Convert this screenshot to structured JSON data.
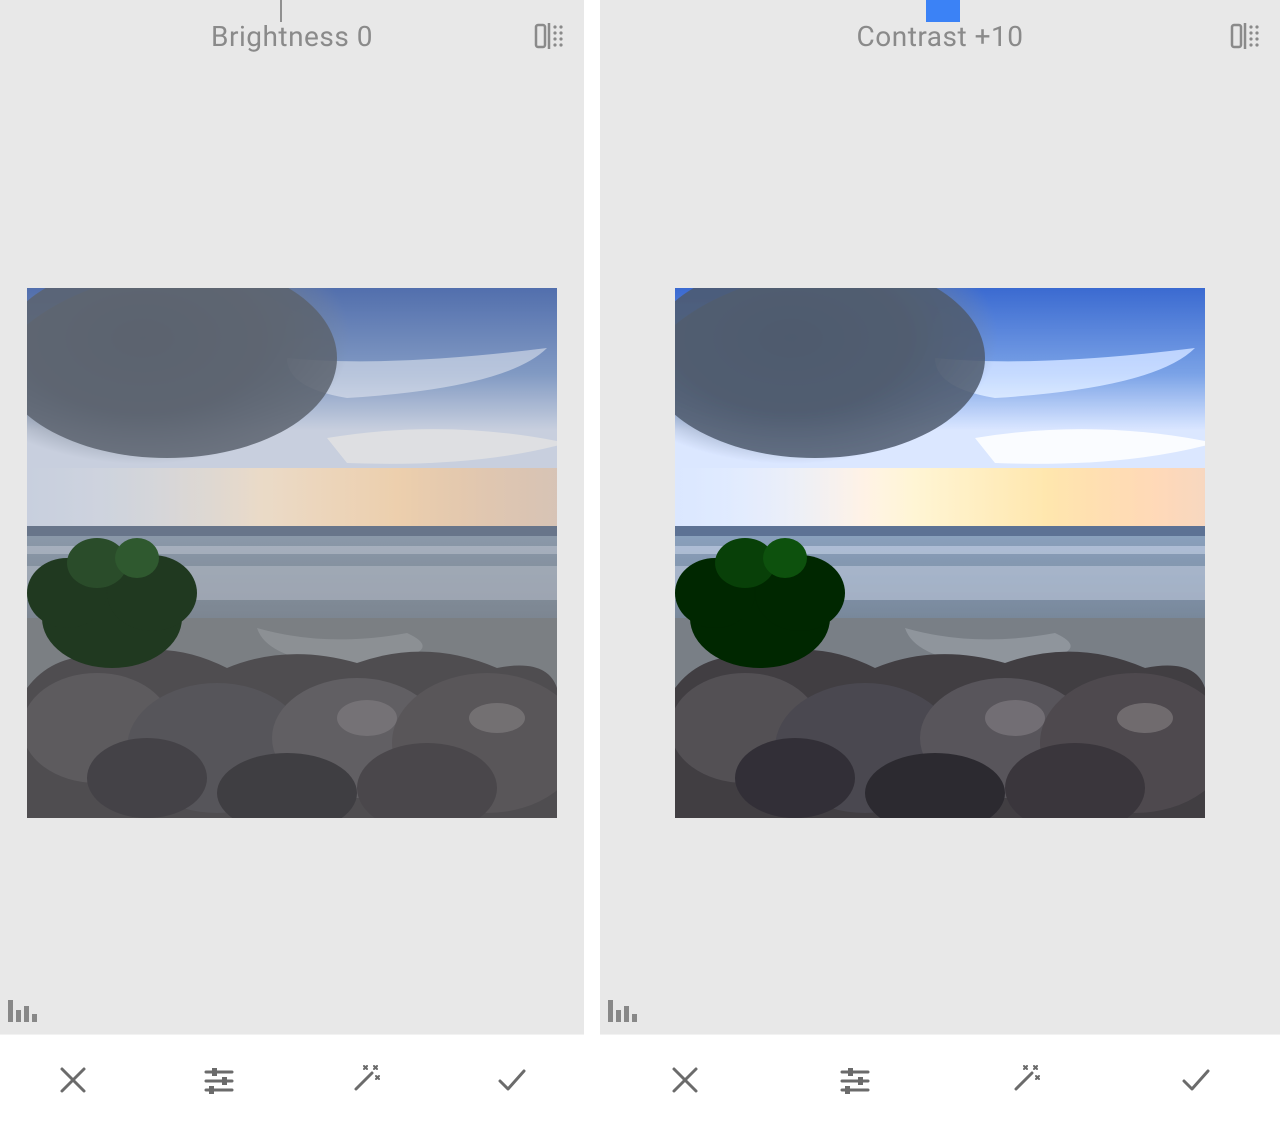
{
  "panes": [
    {
      "title": "Brightness 0",
      "slider": {
        "center_pct": 48,
        "value_offset_pct": 0
      },
      "contrast_filter": 100
    },
    {
      "title": "Contrast +10",
      "slider": {
        "center_pct": 48,
        "value_offset_pct": 5
      },
      "contrast_filter": 130
    }
  ],
  "colors": {
    "accent": "#3b82f6",
    "bg": "#e8e8e8",
    "icon": "#8a8a8a"
  }
}
